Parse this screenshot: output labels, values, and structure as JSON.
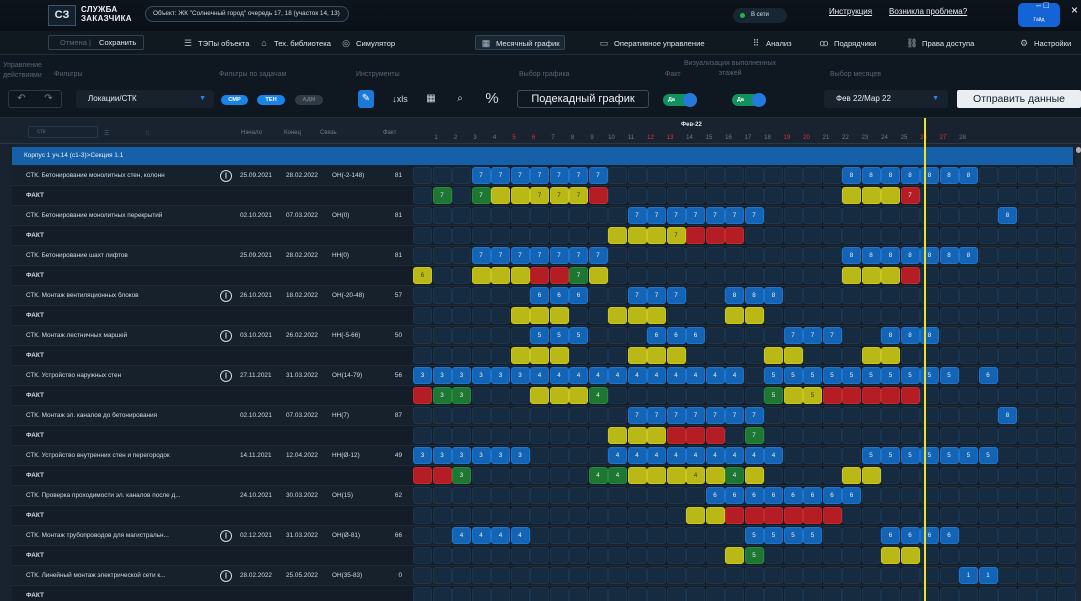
{
  "top": {
    "logo_mark": "СЗ",
    "logo_line1": "СЛУЖБА",
    "logo_line2": "ЗАКАЗЧИКА",
    "object": "Объект: ЖК \"Солнечный город\" очередь 17, 18 (участок 14, 13)",
    "network_status": "В сети",
    "instruction_link": "Инструкция",
    "problem_link": "Возникла проблема?",
    "user_name": "Гайд"
  },
  "menu": {
    "undo": "Отмена",
    "save": "Сохранить",
    "items": [
      "ТЭПы объекта",
      "Тех. библиотека",
      "Симулятор",
      "Месячный график",
      "Оперативное управление",
      "Анализ",
      "Подрядчики",
      "Права доступа",
      "Настройки"
    ],
    "item_icons": [
      "list-icon",
      "building-icon",
      "eye-icon",
      "calendar-icon",
      "screen-icon",
      "grid-icon",
      "people-icon",
      "link-icon",
      "gear-icon"
    ]
  },
  "toolbar": {
    "labels": {
      "actions": "Управление\nдействиями",
      "filters": "Фильтры",
      "task_filters": "Фильтры по задачам",
      "tools": "Инструменты",
      "schedule": "Выбор графика",
      "fact": "Факт",
      "vis": "Визуализация выполненных\nэтажей",
      "months": "Выбор месяцев"
    },
    "filter_value": "Локации/СТК",
    "task_filters": [
      "СМР",
      "ТЕН",
      "АДМ"
    ],
    "xls": "↓xls",
    "percent": "%",
    "schedule_value": "Подекадный график",
    "fact_toggle": "Да",
    "vis_toggle": "Да",
    "months_value": "Фев 22/Мар 22",
    "send_button": "Отправить данные"
  },
  "grid": {
    "search_value": "стк",
    "col_start": "Начало",
    "col_end": "Конец",
    "col_link": "Связь",
    "col_fact": "Факт",
    "month": "Фев-22",
    "days": [
      "1",
      "2",
      "3",
      "4",
      "5",
      "6",
      "7",
      "8",
      "9",
      "10",
      "11",
      "12",
      "13",
      "14",
      "15",
      "16",
      "17",
      "18",
      "19",
      "20",
      "21",
      "22",
      "23",
      "24",
      "25",
      "26",
      "27",
      "28"
    ],
    "weekend_days": [
      "5",
      "6",
      "12",
      "13",
      "19",
      "20",
      "26",
      "27"
    ],
    "section": "Корпус 1 уч.14 (с1-3)>Секция 1.1",
    "fact_label": "ФАКТ",
    "tasks": [
      {
        "name": "СТК. Бетонирование монолитных стен, колонн",
        "pause": true,
        "start": "25.09.2021",
        "end": "28.02.2022",
        "link": "ОН(-2-148)",
        "fact": "81"
      },
      {
        "name": "СТК. Бетонирование монолитных перекрытий",
        "pause": false,
        "start": "02.10.2021",
        "end": "07.03.2022",
        "link": "ОН(0)",
        "fact": "81"
      },
      {
        "name": "СТК. Бетонирование шахт лифтов",
        "pause": false,
        "start": "25.09.2021",
        "end": "28.02.2022",
        "link": "НН(0)",
        "fact": "81"
      },
      {
        "name": "СТК. Монтаж вентиляционных блоков",
        "pause": true,
        "start": "26.10.2021",
        "end": "18.02.2022",
        "link": "ОН(-20-48)",
        "fact": "57"
      },
      {
        "name": "СТК. Монтаж лестничных маршей",
        "pause": true,
        "start": "03.10.2021",
        "end": "26.02.2022",
        "link": "НН(-5-66)",
        "fact": "50"
      },
      {
        "name": "СТК. Устройство наружных стен",
        "pause": true,
        "start": "27.11.2021",
        "end": "31.03.2022",
        "link": "ОН(14-79)",
        "fact": "56"
      },
      {
        "name": "СТК. Монтаж эл. каналов до бетонирования",
        "pause": false,
        "start": "02.10.2021",
        "end": "07.03.2022",
        "link": "НН(7)",
        "fact": "87"
      },
      {
        "name": "СТК. Устройство внутренних стен и перегородок",
        "pause": false,
        "start": "14.11.2021",
        "end": "12.04.2022",
        "link": "НН(Ø-12)",
        "fact": "49"
      },
      {
        "name": "СТК. Проверка проходимости эл. каналов после д...",
        "pause": false,
        "start": "24.10.2021",
        "end": "30.03.2022",
        "link": "ОН(15)",
        "fact": "62"
      },
      {
        "name": "СТК. Монтаж трубопроводов для магистральн...",
        "pause": true,
        "start": "02.12.2021",
        "end": "31.03.2022",
        "link": "ОН(Ø-81)",
        "fact": "66"
      },
      {
        "name": "СТК. Линейный монтаж электрической сети к...",
        "pause": true,
        "start": "28.02.2022",
        "end": "25.05.2022",
        "link": "ОН(35-83)",
        "fact": "0"
      }
    ],
    "plan_rows": [
      {
        "b": [
          [
            3,
            7
          ],
          [
            4,
            7
          ],
          [
            5,
            7
          ],
          [
            6,
            7
          ],
          [
            7,
            7
          ],
          [
            8,
            7
          ],
          [
            9,
            7
          ],
          [
            22,
            8
          ],
          [
            23,
            8
          ],
          [
            24,
            8
          ],
          [
            25,
            8
          ],
          [
            26,
            8
          ],
          [
            27,
            8
          ],
          [
            28,
            8
          ]
        ]
      },
      {
        "b": [
          [
            11,
            7
          ],
          [
            12,
            7
          ],
          [
            13,
            7
          ],
          [
            14,
            7
          ],
          [
            15,
            7
          ],
          [
            16,
            7
          ],
          [
            17,
            7
          ],
          [
            30,
            8
          ]
        ]
      },
      {
        "b": [
          [
            3,
            7
          ],
          [
            4,
            7
          ],
          [
            5,
            7
          ],
          [
            6,
            7
          ],
          [
            7,
            7
          ],
          [
            8,
            7
          ],
          [
            9,
            7
          ],
          [
            22,
            8
          ],
          [
            23,
            8
          ],
          [
            24,
            8
          ],
          [
            25,
            8
          ],
          [
            26,
            8
          ],
          [
            27,
            8
          ],
          [
            28,
            8
          ]
        ]
      },
      {
        "b": [
          [
            6,
            6
          ],
          [
            7,
            6
          ],
          [
            8,
            6
          ],
          [
            11,
            7
          ],
          [
            12,
            7
          ],
          [
            13,
            7
          ],
          [
            16,
            8
          ],
          [
            17,
            8
          ],
          [
            18,
            8
          ]
        ]
      },
      {
        "b": [
          [
            6,
            5
          ],
          [
            7,
            5
          ],
          [
            8,
            5
          ],
          [
            12,
            6
          ],
          [
            13,
            6
          ],
          [
            14,
            6
          ],
          [
            19,
            7
          ],
          [
            20,
            7
          ],
          [
            21,
            7
          ],
          [
            24,
            8
          ],
          [
            25,
            8
          ],
          [
            26,
            8
          ]
        ]
      },
      {
        "b": [
          [
            0,
            3
          ],
          [
            1,
            3
          ],
          [
            2,
            3
          ],
          [
            3,
            3
          ],
          [
            4,
            3
          ],
          [
            5,
            3
          ],
          [
            6,
            4
          ],
          [
            7,
            4
          ],
          [
            8,
            4
          ],
          [
            9,
            4
          ],
          [
            10,
            4
          ],
          [
            11,
            4
          ],
          [
            12,
            4
          ],
          [
            13,
            4
          ],
          [
            14,
            4
          ],
          [
            15,
            4
          ],
          [
            16,
            4
          ],
          [
            18,
            5
          ],
          [
            19,
            5
          ],
          [
            20,
            5
          ],
          [
            21,
            5
          ],
          [
            22,
            5
          ],
          [
            23,
            5
          ],
          [
            24,
            5
          ],
          [
            25,
            5
          ],
          [
            26,
            5
          ],
          [
            27,
            5
          ],
          [
            29,
            6
          ]
        ]
      },
      {
        "b": [
          [
            11,
            7
          ],
          [
            12,
            7
          ],
          [
            13,
            7
          ],
          [
            14,
            7
          ],
          [
            15,
            7
          ],
          [
            16,
            7
          ],
          [
            17,
            7
          ],
          [
            30,
            8
          ]
        ]
      },
      {
        "b": [
          [
            0,
            3
          ],
          [
            1,
            3
          ],
          [
            2,
            3
          ],
          [
            3,
            3
          ],
          [
            4,
            3
          ],
          [
            5,
            3
          ],
          [
            10,
            4
          ],
          [
            11,
            4
          ],
          [
            12,
            4
          ],
          [
            13,
            4
          ],
          [
            14,
            4
          ],
          [
            15,
            4
          ],
          [
            16,
            4
          ],
          [
            17,
            4
          ],
          [
            18,
            4
          ],
          [
            23,
            5
          ],
          [
            24,
            5
          ],
          [
            25,
            5
          ],
          [
            26,
            5
          ],
          [
            27,
            5
          ],
          [
            28,
            5
          ],
          [
            29,
            5
          ]
        ]
      },
      {
        "b": [
          [
            15,
            6
          ],
          [
            16,
            6
          ],
          [
            17,
            6
          ],
          [
            18,
            6
          ],
          [
            19,
            6
          ],
          [
            20,
            6
          ],
          [
            21,
            6
          ],
          [
            22,
            6
          ]
        ]
      },
      {
        "b": [
          [
            2,
            4
          ],
          [
            3,
            4
          ],
          [
            4,
            4
          ],
          [
            5,
            4
          ],
          [
            17,
            5
          ],
          [
            18,
            5
          ],
          [
            19,
            5
          ],
          [
            20,
            5
          ],
          [
            24,
            6
          ],
          [
            25,
            6
          ],
          [
            26,
            6
          ],
          [
            27,
            6
          ]
        ]
      },
      {
        "b": [
          [
            28,
            1
          ],
          [
            29,
            1
          ]
        ]
      }
    ],
    "fact_rows": [
      {
        "g": [
          [
            1,
            "7"
          ],
          [
            3,
            "7"
          ]
        ],
        "y": [
          [
            4,
            ""
          ],
          [
            5,
            ""
          ],
          [
            6,
            "7"
          ],
          [
            7,
            "7"
          ],
          [
            8,
            "7"
          ],
          [
            22,
            ""
          ],
          [
            23,
            ""
          ],
          [
            24,
            ""
          ]
        ],
        "r": [
          [
            9,
            ""
          ],
          [
            25,
            "7"
          ]
        ]
      },
      {
        "g": [],
        "y": [
          [
            10,
            ""
          ],
          [
            11,
            ""
          ],
          [
            12,
            ""
          ],
          [
            13,
            "7"
          ]
        ],
        "r": [
          [
            14,
            ""
          ],
          [
            15,
            ""
          ],
          [
            16,
            ""
          ]
        ]
      },
      {
        "g": [
          [
            8,
            "7"
          ]
        ],
        "y": [
          [
            0,
            "6"
          ],
          [
            3,
            ""
          ],
          [
            4,
            ""
          ],
          [
            5,
            ""
          ],
          [
            9,
            ""
          ],
          [
            22,
            ""
          ],
          [
            23,
            ""
          ],
          [
            24,
            ""
          ]
        ],
        "r": [
          [
            6,
            ""
          ],
          [
            7,
            ""
          ],
          [
            25,
            ""
          ]
        ]
      },
      {
        "g": [],
        "y": [
          [
            5,
            ""
          ],
          [
            6,
            ""
          ],
          [
            7,
            ""
          ],
          [
            10,
            ""
          ],
          [
            11,
            ""
          ],
          [
            12,
            ""
          ],
          [
            16,
            ""
          ],
          [
            17,
            ""
          ]
        ],
        "r": []
      },
      {
        "g": [],
        "y": [
          [
            5,
            ""
          ],
          [
            6,
            ""
          ],
          [
            7,
            ""
          ],
          [
            11,
            ""
          ],
          [
            12,
            ""
          ],
          [
            13,
            ""
          ],
          [
            18,
            ""
          ],
          [
            19,
            ""
          ],
          [
            23,
            ""
          ],
          [
            24,
            ""
          ]
        ],
        "r": []
      },
      {
        "g": [
          [
            1,
            "3"
          ],
          [
            2,
            "3"
          ],
          [
            9,
            "4"
          ],
          [
            18,
            "5"
          ]
        ],
        "y": [
          [
            6,
            ""
          ],
          [
            7,
            ""
          ],
          [
            8,
            ""
          ],
          [
            19,
            ""
          ],
          [
            20,
            "5"
          ]
        ],
        "r": [
          [
            0,
            ""
          ],
          [
            21,
            ""
          ],
          [
            22,
            ""
          ],
          [
            23,
            ""
          ],
          [
            24,
            ""
          ],
          [
            25,
            ""
          ]
        ]
      },
      {
        "g": [
          [
            17,
            "7"
          ]
        ],
        "y": [
          [
            10,
            ""
          ],
          [
            11,
            ""
          ],
          [
            12,
            ""
          ]
        ],
        "r": [
          [
            13,
            ""
          ],
          [
            14,
            ""
          ],
          [
            15,
            ""
          ]
        ]
      },
      {
        "g": [
          [
            2,
            "3"
          ],
          [
            9,
            "4"
          ],
          [
            10,
            "4"
          ],
          [
            16,
            "4"
          ]
        ],
        "y": [
          [
            11,
            ""
          ],
          [
            12,
            ""
          ],
          [
            13,
            ""
          ],
          [
            14,
            "4"
          ],
          [
            15,
            ""
          ],
          [
            17,
            ""
          ],
          [
            22,
            ""
          ],
          [
            23,
            ""
          ]
        ],
        "r": [
          [
            0,
            ""
          ],
          [
            1,
            ""
          ]
        ]
      },
      {
        "g": [],
        "y": [
          [
            14,
            ""
          ],
          [
            15,
            ""
          ]
        ],
        "r": [
          [
            16,
            ""
          ],
          [
            17,
            ""
          ],
          [
            18,
            ""
          ],
          [
            19,
            ""
          ],
          [
            20,
            ""
          ],
          [
            21,
            ""
          ]
        ]
      },
      {
        "g": [
          [
            17,
            "5"
          ]
        ],
        "y": [
          [
            16,
            ""
          ],
          [
            24,
            ""
          ],
          [
            25,
            ""
          ]
        ],
        "r": []
      },
      {
        "g": [],
        "y": [],
        "r": []
      }
    ]
  },
  "colors": {
    "accent_blue": "#1660a8",
    "plan_cell": "#1364b5",
    "fact_green": "#1d7631",
    "fact_yellow": "#b9b816",
    "fact_red": "#b41d24",
    "today_line": "#eee12c"
  }
}
